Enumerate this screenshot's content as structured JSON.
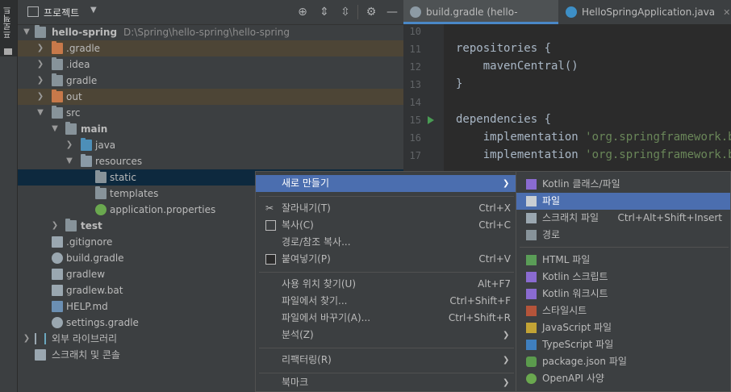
{
  "toolwindow": {
    "vertical_label": "프로젝트"
  },
  "project_panel": {
    "title": "프로젝트",
    "header_icons": [
      "crosshair-icon",
      "expand-all-icon",
      "collapse-all-icon",
      "settings-icon",
      "hide-icon"
    ],
    "tree": [
      {
        "label": "hello-spring",
        "path": "D:\\Spring\\hello-spring\\hello-spring",
        "bold": true,
        "expanded": true
      },
      {
        "label": ".gradle",
        "excluded": true
      },
      {
        "label": ".idea"
      },
      {
        "label": "gradle"
      },
      {
        "label": "out",
        "excluded": true
      },
      {
        "label": "src",
        "expanded": true
      },
      {
        "label": "main",
        "bold": true,
        "expanded": true
      },
      {
        "label": "java"
      },
      {
        "label": "resources",
        "expanded": true
      },
      {
        "label": "static",
        "selected": true
      },
      {
        "label": "templates"
      },
      {
        "label": "application.properties"
      },
      {
        "label": "test",
        "bold": true
      },
      {
        "label": ".gitignore"
      },
      {
        "label": "build.gradle"
      },
      {
        "label": "gradlew"
      },
      {
        "label": "gradlew.bat"
      },
      {
        "label": "HELP.md"
      },
      {
        "label": "settings.gradle"
      },
      {
        "label": "외부 라이브러리"
      },
      {
        "label": "스크래치 및 콘솔"
      }
    ]
  },
  "editor": {
    "tabs": [
      {
        "label": "build.gradle (hello-spring)",
        "active": true
      },
      {
        "label": "HelloSpringApplication.java",
        "active": false
      }
    ],
    "lines": [
      {
        "n": "10",
        "text": ""
      },
      {
        "n": "11",
        "text": "repositories {"
      },
      {
        "n": "12",
        "text": "    mavenCentral()"
      },
      {
        "n": "13",
        "text": "}"
      },
      {
        "n": "14",
        "text": ""
      },
      {
        "n": "15",
        "text": "dependencies {"
      },
      {
        "n": "16",
        "text": "    implementation ",
        "str": "'org.springframework.boo"
      },
      {
        "n": "17",
        "text": "    implementation ",
        "str": "'org.springframework.boo"
      }
    ]
  },
  "context_menu": {
    "items": [
      {
        "label": "새로 만들기",
        "shortcut": "",
        "submenu": true,
        "selected": true
      },
      {
        "label": "잘라내기(T)",
        "shortcut": "Ctrl+X",
        "icon": "scissors-icon"
      },
      {
        "label": "복사(C)",
        "shortcut": "Ctrl+C",
        "icon": "copy-icon"
      },
      {
        "label": "경로/참조 복사...",
        "shortcut": ""
      },
      {
        "label": "붙여넣기(P)",
        "shortcut": "Ctrl+V",
        "icon": "paste-icon"
      },
      {
        "label": "사용 위치 찾기(U)",
        "shortcut": "Alt+F7"
      },
      {
        "label": "파일에서 찾기...",
        "shortcut": "Ctrl+Shift+F"
      },
      {
        "label": "파일에서 바꾸기(A)...",
        "shortcut": "Ctrl+Shift+R"
      },
      {
        "label": "분석(Z)",
        "shortcut": "",
        "submenu": true
      },
      {
        "label": "리팩터링(R)",
        "shortcut": "",
        "submenu": true
      },
      {
        "label": "북마크",
        "shortcut": "",
        "submenu": true
      }
    ]
  },
  "new_submenu": {
    "items": [
      {
        "label": "Kotlin 클래스/파일",
        "shortcut": "",
        "icon": "kotlin-icon"
      },
      {
        "label": "파일",
        "shortcut": "",
        "icon": "file-icon",
        "selected": true
      },
      {
        "label": "스크래치 파일",
        "shortcut": "Ctrl+Alt+Shift+Insert",
        "icon": "scratch-file-icon"
      },
      {
        "label": "경로",
        "shortcut": "",
        "icon": "folder-icon"
      },
      {
        "label": "HTML 파일",
        "shortcut": "",
        "icon": "html-icon"
      },
      {
        "label": "Kotlin 스크립트",
        "shortcut": "",
        "icon": "kotlin-script-icon"
      },
      {
        "label": "Kotlin 워크시트",
        "shortcut": "",
        "icon": "kotlin-worksheet-icon"
      },
      {
        "label": "스타일시트",
        "shortcut": "",
        "icon": "css-icon"
      },
      {
        "label": "JavaScript 파일",
        "shortcut": "",
        "icon": "javascript-icon"
      },
      {
        "label": "TypeScript 파일",
        "shortcut": "",
        "icon": "typescript-icon"
      },
      {
        "label": "package.json 파일",
        "shortcut": "",
        "icon": "npm-icon"
      },
      {
        "label": "OpenAPI 사양",
        "shortcut": "",
        "icon": "openapi-icon"
      }
    ]
  },
  "colors": {
    "selection_blue": "#4b6eaf",
    "excluded_bg": "#4d4536",
    "tree_selected_bg": "#0d293e",
    "string_green": "#6a8759"
  }
}
